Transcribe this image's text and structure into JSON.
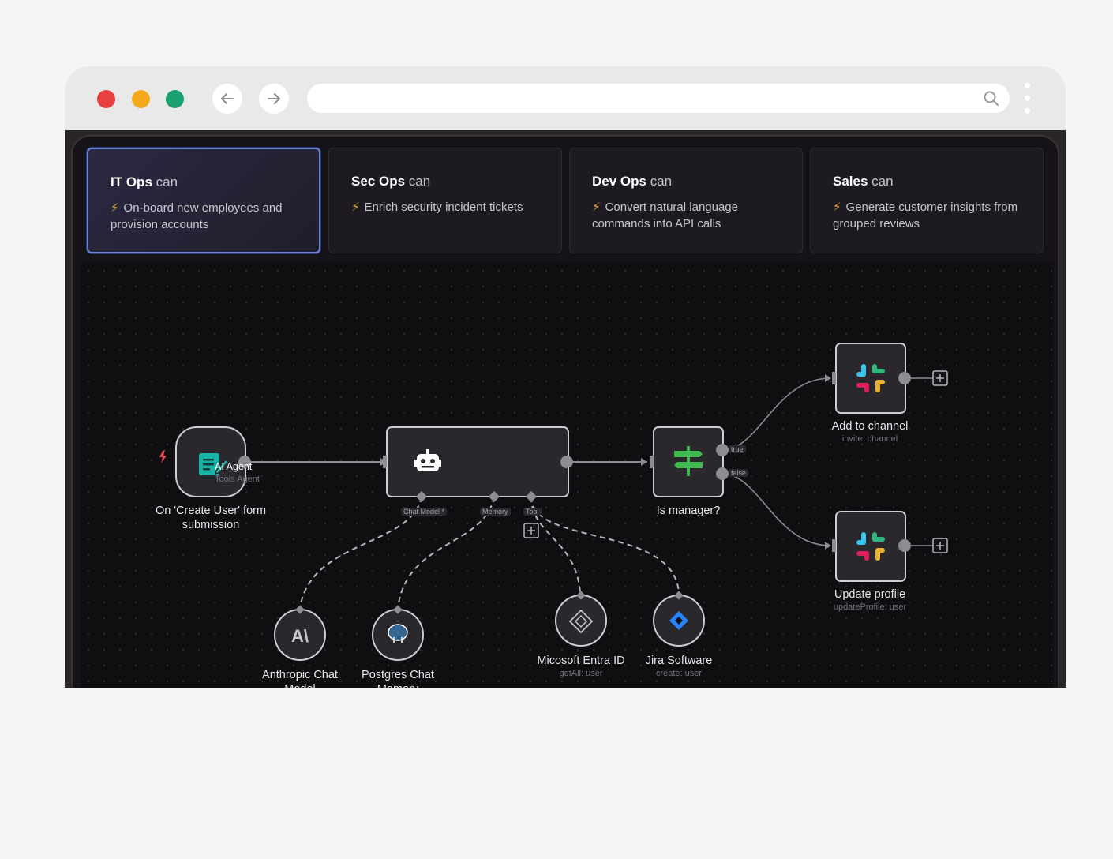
{
  "cards": [
    {
      "team": "IT Ops",
      "suffix": "can",
      "desc": "On-board new employees and provision accounts",
      "active": true
    },
    {
      "team": "Sec Ops",
      "suffix": "can",
      "desc": "Enrich security incident tickets",
      "active": false
    },
    {
      "team": "Dev Ops",
      "suffix": "can",
      "desc": "Convert natural language commands into API calls",
      "active": false
    },
    {
      "team": "Sales",
      "suffix": "can",
      "desc": "Generate customer insights from grouped reviews",
      "active": false
    }
  ],
  "bolt": "⚡",
  "nodes": {
    "trigger": {
      "label": "On 'Create User' form submission"
    },
    "agent": {
      "title": "AI Agent",
      "subtitle": "Tools Agent"
    },
    "if": {
      "label": "Is manager?",
      "true_label": "true",
      "false_label": "false"
    },
    "slack1": {
      "label": "Add to channel",
      "sub": "invite: channel"
    },
    "slack2": {
      "label": "Update profile",
      "sub": "updateProfile: user"
    },
    "anthropic": {
      "label": "Anthropic Chat Model"
    },
    "postgres": {
      "label": "Postgres Chat Memory"
    },
    "entra": {
      "label": "Micosoft Entra ID",
      "sub": "getAll: user"
    },
    "jira": {
      "label": "Jira Software",
      "sub": "create: user"
    }
  },
  "ports": {
    "chat_model": "Chat Model *",
    "memory": "Memory",
    "tool": "Tool"
  },
  "colors": {
    "accent": "#6a86d6",
    "canvas": "#0f0e10",
    "node_fill": "#2a282d",
    "node_stroke": "#cfcdd3",
    "bolt": "#f0a930"
  }
}
